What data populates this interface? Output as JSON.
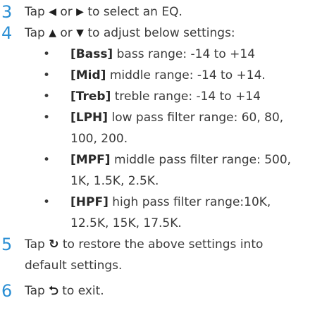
{
  "steps": {
    "s3": {
      "number": "3",
      "before": "Tap",
      "left_icon": "◀",
      "mid": "or",
      "right_icon": "▶",
      "after": "to select an EQ."
    },
    "s4": {
      "number": "4",
      "before": "Tap",
      "up_icon": "▲",
      "mid": "or",
      "down_icon": "▼",
      "after": "to adjust below settings:"
    },
    "s5": {
      "number": "5",
      "before": "Tap",
      "restore_icon": "↻",
      "line1_after": "to restore the above settings into",
      "line2": "default settings."
    },
    "s6": {
      "number": "6",
      "before": "Tap",
      "back_icon": "⮌",
      "after": "to exit."
    }
  },
  "bullets": [
    {
      "symbol": "•",
      "keyword": "[Bass]",
      "desc": "bass range: -14 to +14"
    },
    {
      "symbol": "•",
      "keyword": "[Mid]",
      "desc": "middle range: -14 to +14."
    },
    {
      "symbol": "•",
      "keyword": "[Treb]",
      "desc": "treble range: -14 to +14"
    },
    {
      "symbol": "•",
      "keyword": "[LPH]",
      "desc": "low pass filter range: 60, 80,",
      "desc2": "100, 200."
    },
    {
      "symbol": "•",
      "keyword": "[MPF]",
      "desc": "middle pass filter range: 500,",
      "desc2": "1K, 1.5K, 2.5K."
    },
    {
      "symbol": "•",
      "keyword": "[HPF]",
      "desc": "high pass filter range:10K,",
      "desc2": "12.5K, 15K, 17.5K."
    }
  ],
  "colors": {
    "step_number": "#2b8fd4",
    "body_text": "#3a3a3a"
  }
}
